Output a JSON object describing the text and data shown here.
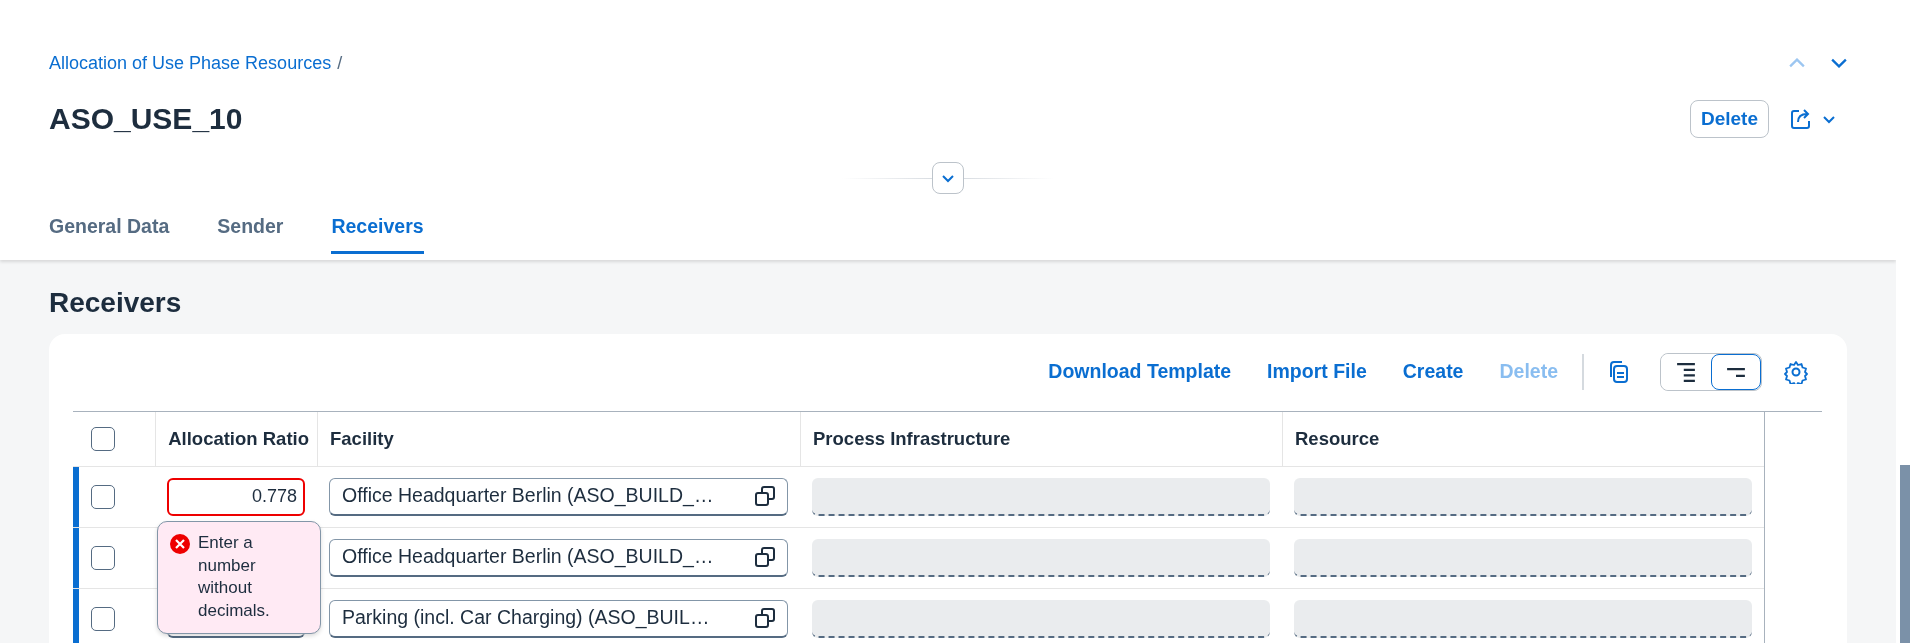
{
  "breadcrumb": {
    "link": "Allocation of Use Phase Resources",
    "separator": "/"
  },
  "nav": [
    {
      "kind": "up",
      "disabled": true
    },
    {
      "kind": "down",
      "disabled": false
    }
  ],
  "title": "ASO_USE_10",
  "header_actions": [
    {
      "kind": "text",
      "label": "Delete"
    },
    {
      "kind": "share"
    }
  ],
  "tabs": [
    {
      "label": "General Data",
      "selected": false
    },
    {
      "label": "Sender",
      "selected": false
    },
    {
      "label": "Receivers",
      "selected": true
    }
  ],
  "section_title": "Receivers",
  "toolbar": {
    "actions": [
      {
        "label": "Download Template",
        "disabled": false
      },
      {
        "label": "Import File",
        "disabled": false
      },
      {
        "label": "Create",
        "disabled": false
      },
      {
        "label": "Delete",
        "disabled": true
      }
    ],
    "toggles": [
      {
        "kind": "list",
        "selected": false
      },
      {
        "kind": "lines",
        "selected": true
      }
    ]
  },
  "table": {
    "select_all_checked": false,
    "columns": [
      "Allocation Ratio",
      "Facility",
      "Process Infrastructure",
      "Resource"
    ],
    "rows": [
      {
        "highlighted": true,
        "checked": false,
        "allocation_ratio": {
          "value": "0.778",
          "error_message": "Enter a number without decimals."
        },
        "facility": "Office Headquarter Berlin (ASO_BUILD_…"
      },
      {
        "highlighted": true,
        "checked": false,
        "allocation_ratio": {},
        "facility": "Office Headquarter Berlin (ASO_BUILD_…"
      },
      {
        "highlighted": true,
        "checked": false,
        "allocation_ratio": {},
        "facility": "Parking (incl. Car Charging) (ASO_BUIL…"
      }
    ]
  }
}
